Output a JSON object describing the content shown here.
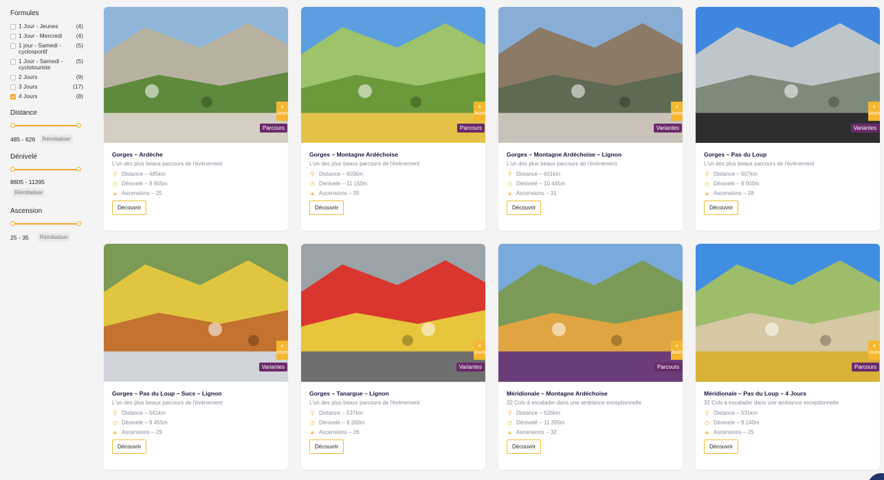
{
  "filters": {
    "formules_title": "Formules",
    "formules": [
      {
        "label": "1 Jour - Jeunes",
        "count": "(4)",
        "checked": false
      },
      {
        "label": "1 Jour - Mercredi",
        "count": "(4)",
        "checked": false
      },
      {
        "label": "1 jour - Samedi - cyclosportif",
        "count": "(5)",
        "checked": false
      },
      {
        "label": "1 Jour - Samedi - cyclotouriste",
        "count": "(5)",
        "checked": false
      },
      {
        "label": "2 Jours",
        "count": "(9)",
        "checked": false
      },
      {
        "label": "3 Jours",
        "count": "(17)",
        "checked": false
      },
      {
        "label": "4 Jours",
        "count": "(8)",
        "checked": true
      }
    ],
    "distance": {
      "title": "Distance",
      "range": "485 - 626",
      "reset": "Réinitialiser"
    },
    "denivele": {
      "title": "Dénivelé",
      "range": "8805 - 11395",
      "reset": "Réinitialiser"
    },
    "ascension": {
      "title": "Ascension",
      "range": "25 - 35",
      "reset": "Réinitialiser"
    }
  },
  "accent_color": "#f5b72f",
  "badge_color": "#6a2a6a",
  "cards": [
    {
      "title": "Gorges – Ardèche",
      "subtitle": "L'un des plus beaux parcours de l'évènement",
      "distance": "Distance – 485km",
      "denivele": "Dénivelé – 8 805m",
      "ascensions": "Ascensions – 25",
      "days": "4",
      "days_unit": "Jours",
      "type": "Parcours",
      "button": "Découvrir"
    },
    {
      "title": "Gorges – Montagne Ardéchoise",
      "subtitle": "L'un des plus beaux parcours de l'évènement",
      "distance": "Distance – 603km",
      "denivele": "Dénivelé – 11 150m",
      "ascensions": "Ascensions – 35",
      "days": "4",
      "days_unit": "Jours",
      "type": "Parcours",
      "button": "Découvrir"
    },
    {
      "title": "Gorges – Montagne Ardéchoise – Lignon",
      "subtitle": "L'un des plus beaux parcours de l'évènement",
      "distance": "Distance – 601km",
      "denivele": "Dénivelé – 10 445m",
      "ascensions": "Ascensions – 31",
      "days": "4",
      "days_unit": "Jours",
      "type": "Variantes",
      "button": "Découvrir"
    },
    {
      "title": "Gorges – Pas du Loup",
      "subtitle": "L'un des plus beaux parcours de l'évènement",
      "distance": "Distance – 507km",
      "denivele": "Dénivelé – 9 000m",
      "ascensions": "Ascensions – 28",
      "days": "4",
      "days_unit": "Jours",
      "type": "Variantes",
      "button": "Découvrir"
    },
    {
      "title": "Gorges – Pas du Loup – Sucs – Lignon",
      "subtitle": "L'un des plus beaux parcours de l'évènement",
      "distance": "Distance – 561km",
      "denivele": "Dénivelé – 9 455m",
      "ascensions": "Ascensions – 29",
      "days": "4",
      "days_unit": "Jours",
      "type": "Variantes",
      "button": "Découvrir"
    },
    {
      "title": "Gorges – Tanargue – Lignon",
      "subtitle": "L'un des plus beaux parcours de l'évènement",
      "distance": "Distance – 537km",
      "denivele": "Dénivelé – 9 260m",
      "ascensions": "Ascensions – 26",
      "days": "4",
      "days_unit": "Jours",
      "type": "Variantes",
      "button": "Découvrir"
    },
    {
      "title": "Méridionale – Montagne Ardéchoise",
      "subtitle": "32 Cols à escalader dans une ambiance exceptionnelle",
      "distance": "Distance – 626km",
      "denivele": "Dénivelé – 11 395m",
      "ascensions": "Ascensions – 32",
      "days": "4",
      "days_unit": "Jours",
      "type": "Parcours",
      "button": "Découvrir"
    },
    {
      "title": "Méridionale – Pas du Loup – 4 Jours",
      "subtitle": "32 Cols à escalader dans une ambiance exceptionnelle",
      "distance": "Distance – 531km",
      "denivele": "Dénivelé – 9 240m",
      "ascensions": "Ascensions – 25",
      "days": "4",
      "days_unit": "Jours",
      "type": "Parcours",
      "button": "Découvrir"
    }
  ]
}
